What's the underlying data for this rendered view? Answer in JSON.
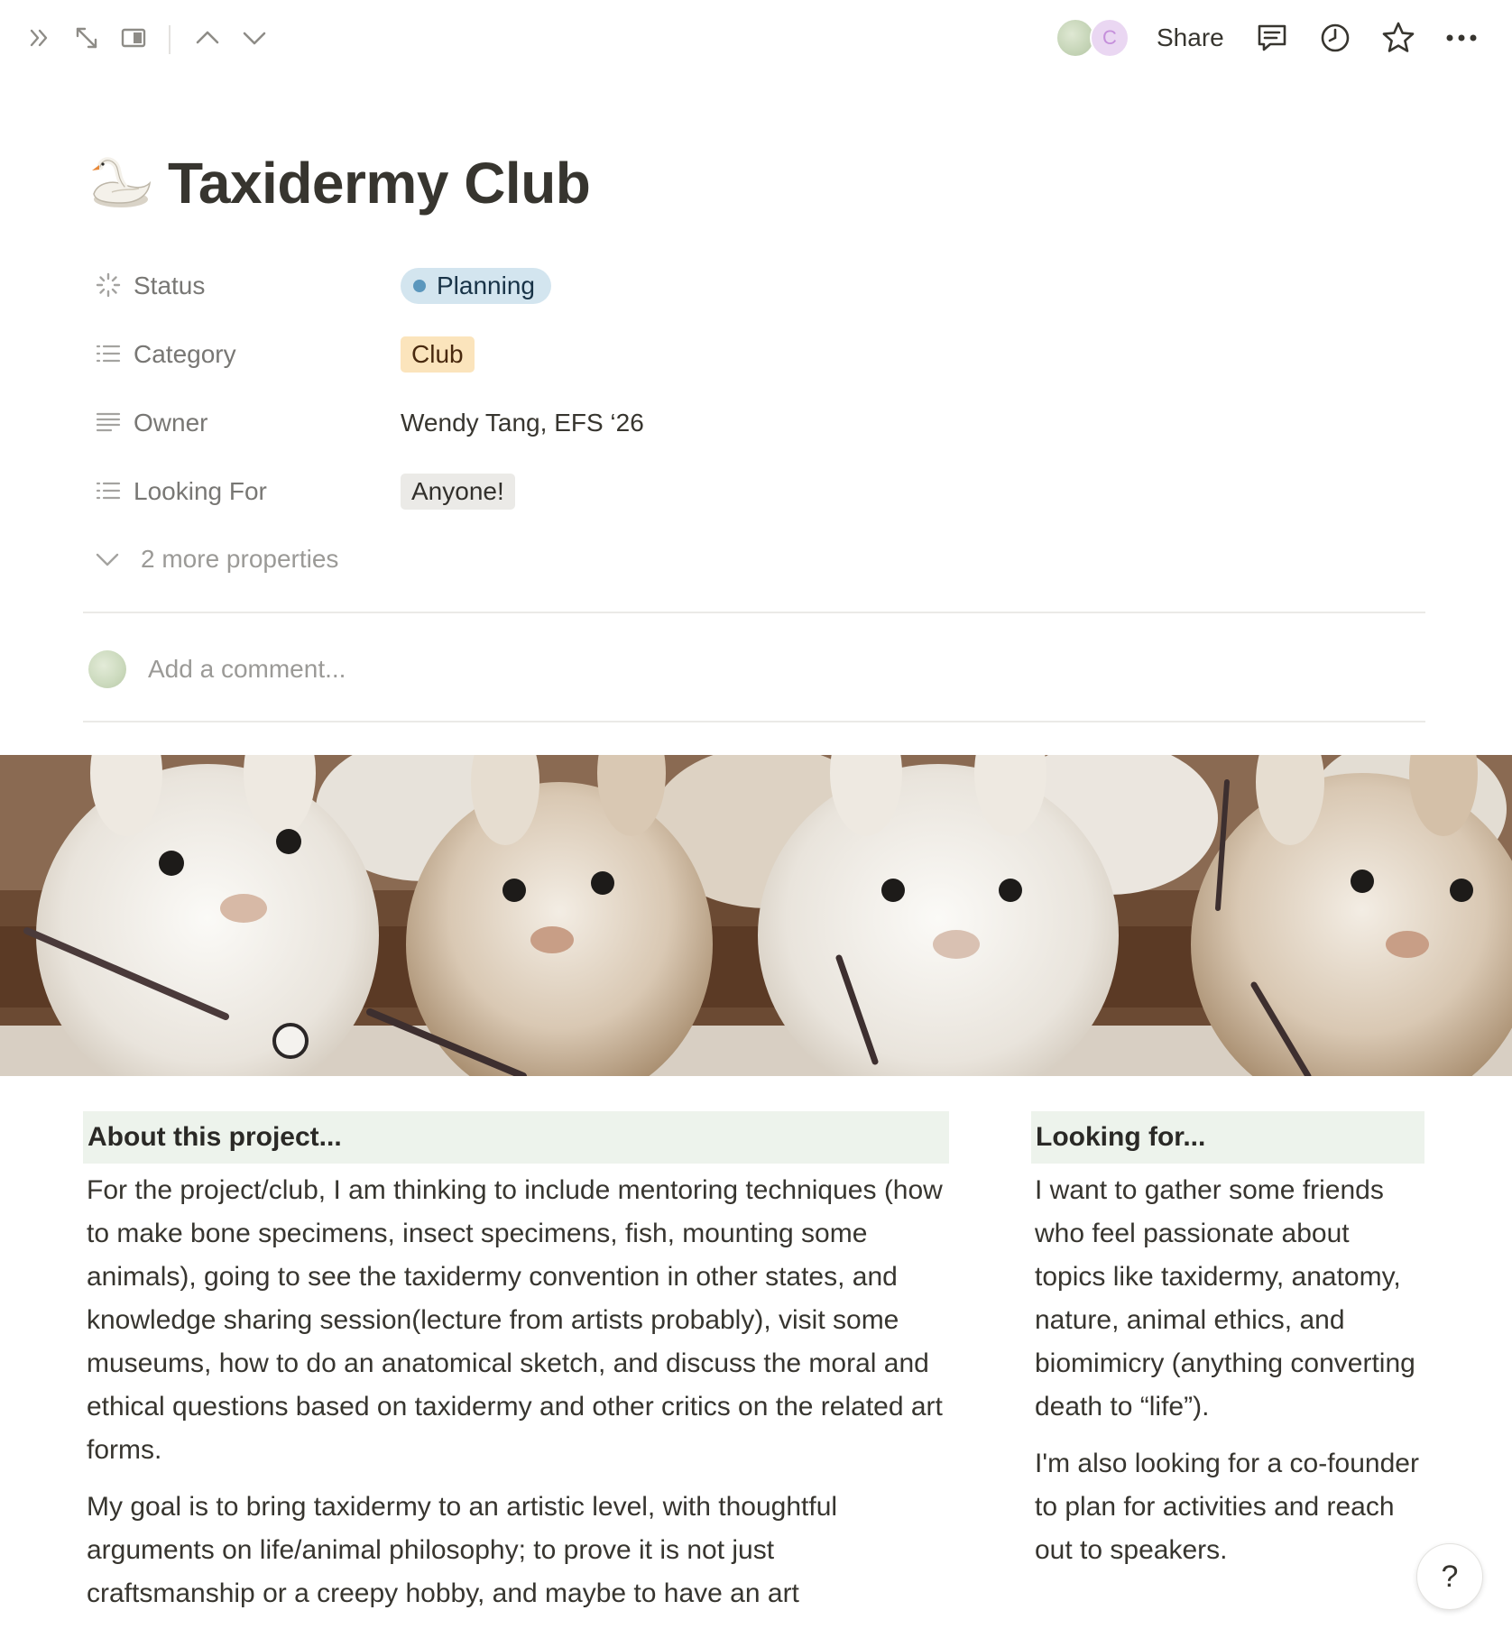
{
  "topbar": {
    "icons": [
      "sidebar-expand-icon",
      "fullscreen-icon",
      "side-peek-icon",
      "chevron-up-icon",
      "chevron-down-icon",
      "comments-icon",
      "history-icon",
      "star-icon",
      "more-icon"
    ],
    "avatar_initial": "C",
    "share_label": "Share"
  },
  "page": {
    "icon": "swan",
    "title": "Taxidermy Club"
  },
  "properties": [
    {
      "name": "Status",
      "icon": "status-icon",
      "value": "Planning",
      "color": "#d3e5ef"
    },
    {
      "name": "Category",
      "icon": "list-icon",
      "value": "Club",
      "color": "#fbe4bc"
    },
    {
      "name": "Owner",
      "icon": "text-icon",
      "value": "Wendy Tang, EFS ‘26"
    },
    {
      "name": "Looking For",
      "icon": "list-icon",
      "value": "Anyone!",
      "color": "#ebeae7"
    }
  ],
  "more_properties": "2 more properties",
  "comment": {
    "placeholder": "Add a comment..."
  },
  "about": {
    "heading": "About this project...",
    "paragraphs": [
      "For the project/club, I am thinking to include mentoring techniques (how to make bone specimens, insect specimens, fish, mounting some animals), going to see the taxidermy convention in other states, and knowledge sharing session(lecture from artists probably), visit some museums, how to do an anatomical sketch, and discuss the moral and ethical questions based on taxidermy and other critics on the related art forms.",
      "My goal is to bring taxidermy to an artistic level, with thoughtful arguments on life/animal philosophy; to prove it is not just craftsmanship or a creepy hobby, and maybe to have an art"
    ]
  },
  "looking_for": {
    "heading": "Looking for...",
    "paragraphs": [
      "I want to gather some friends who feel passionate about topics like taxidermy, anatomy, nature, animal ethics, and biomimicry (anything converting death to “life”).",
      "I'm also looking for a co-founder to plan for activities and reach out to speakers."
    ]
  },
  "help_label": "?",
  "colors": {
    "callout_bg": "#edf3ec",
    "status_dot": "#5b97bd"
  }
}
